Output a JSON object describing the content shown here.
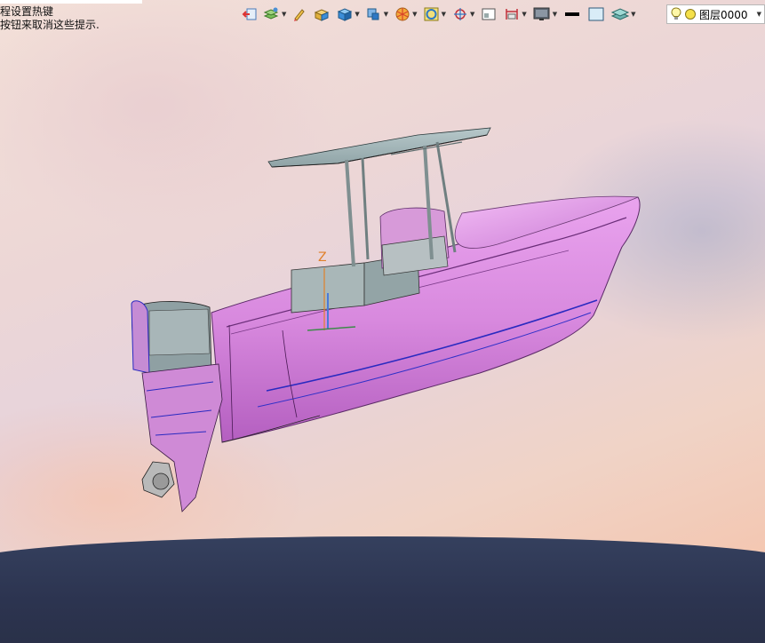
{
  "hint": {
    "line1": "程设置热键",
    "line2": "按钮来取消这些提示."
  },
  "toolbar": {
    "items": [
      {
        "icon": "undo-view-icon"
      },
      {
        "icon": "layer-properties-icon"
      },
      {
        "icon": "pencil-icon"
      },
      {
        "icon": "box-solid-icon"
      },
      {
        "icon": "cube-solid-icon"
      },
      {
        "icon": "shade-mode-icon"
      },
      {
        "icon": "render-sphere-icon"
      },
      {
        "icon": "circle-snap-icon"
      },
      {
        "icon": "target-snap-icon"
      },
      {
        "icon": "view-window-icon"
      },
      {
        "icon": "dimension-icon"
      },
      {
        "icon": "monitor-icon"
      },
      {
        "icon": "line-weight-icon"
      },
      {
        "icon": "fill-color-icon"
      },
      {
        "icon": "layer-stack-icon"
      }
    ],
    "layer_value": "图层0000"
  },
  "viewport": {
    "axis_label": "Z",
    "model_color": "#d98be0",
    "accent_colors": {
      "hull": "#d889de",
      "hull_shadow": "#b964c6",
      "deck": "#a9b7b8",
      "canopy": "#9fb3b5",
      "ground": "#2c3450"
    }
  }
}
